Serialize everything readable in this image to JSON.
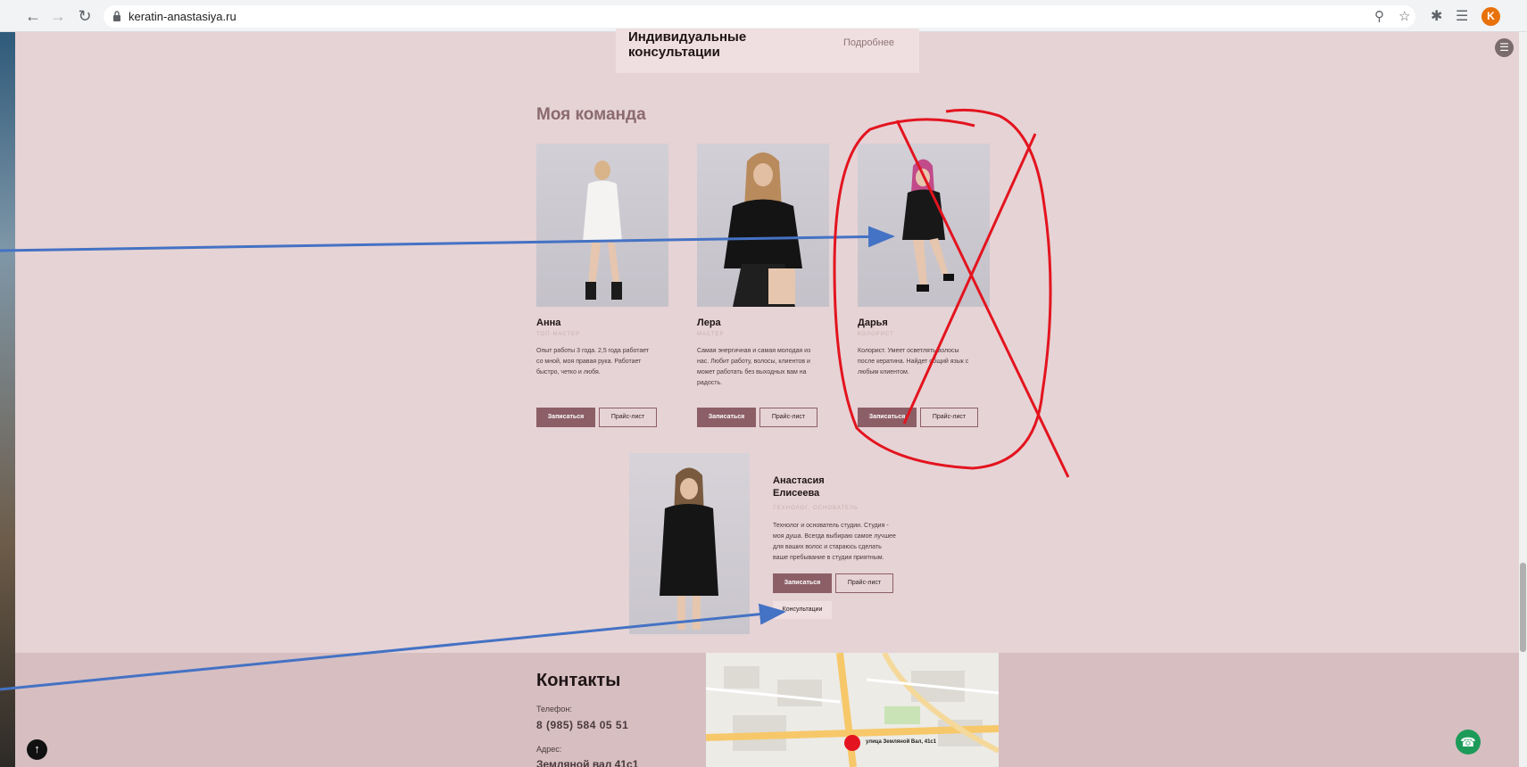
{
  "browser": {
    "url": "keratin-anastasiya.ru",
    "profile_initial": "K"
  },
  "consult_card": {
    "title": "Индивидуальные консультации",
    "more": "Подробнее"
  },
  "team": {
    "title": "Моя команда",
    "book_label": "Записаться",
    "price_label": "Прайс-лист",
    "members": [
      {
        "name": "Анна",
        "role": "ТОП-МАСТЕР",
        "desc": "Опыт работы 3 года. 2,5 года работает со мной, моя правая рука. Работает быстро, четко и любя."
      },
      {
        "name": "Лера",
        "role": "МАСТЕР",
        "desc": "Самая энергичная и самая молодая из нас. Любит работу, волосы, клиентов и может работать без выходных вам на радость."
      },
      {
        "name": "Дарья",
        "role": "КОЛОРИСТ",
        "desc": "Колорист. Умеет осветлять волосы после кератина. Найдет общий язык с любым клиентом."
      }
    ],
    "founder": {
      "name": "Анастасия Елисеева",
      "role": "ТЕХНОЛОГ, ОСНОВАТЕЛЬ",
      "desc": "Технолог и основатель студии. Студия - моя душа. Всегда выбираю самое лучшее для ваших волос и стараюсь сделать ваше пребывание в студии приятным.",
      "consult_label": "Консультации"
    }
  },
  "contacts": {
    "title": "Контакты",
    "phone_label": "Телефон:",
    "phone": "8 (985) 584 05 51",
    "address_label": "Адрес:",
    "address": "Земляной вал 41с1",
    "map_label": "улица Земляной Вал, 41с1"
  },
  "colors": {
    "page_bg": "#e6d3d5",
    "accent": "#8c5f66",
    "footer_bg": "#d6bec1",
    "annotation_red": "#e3141f",
    "annotation_blue": "#4472c4"
  }
}
